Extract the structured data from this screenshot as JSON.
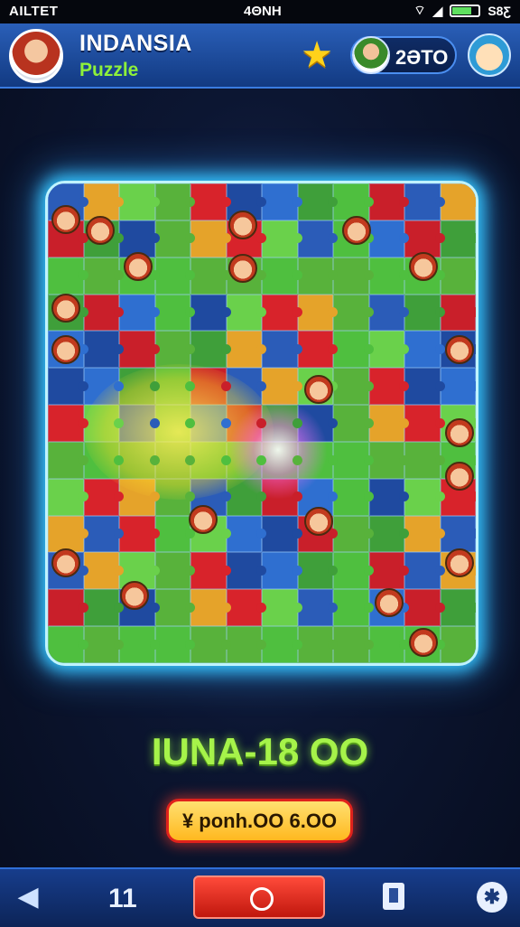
{
  "status_bar": {
    "carrier": "AILTET",
    "time": "4ΘΝΗ",
    "battery_text": "S8Ƹ"
  },
  "header": {
    "title": "INDANSIA",
    "subtitle": "Puzzle",
    "score": "2ƏTO"
  },
  "game": {
    "level_text": "IUNA-18 OO",
    "action_button": "¥ ponh.OO 6.OO"
  },
  "bottom_nav": {
    "count": "11"
  },
  "colors": {
    "header_bg": "#1e4fa8",
    "board_glow": "#35c6ff",
    "level_text": "#a6f34a",
    "cta_bg": "#ffb81f",
    "cta_border": "#e0221c",
    "nav_main": "#d8251a"
  },
  "icons": {
    "header_star": "star-icon",
    "nav_back": "back-arrow-icon",
    "nav_main": "record-circle-icon",
    "nav_doc": "document-icon",
    "nav_settings": "settings-icon"
  }
}
